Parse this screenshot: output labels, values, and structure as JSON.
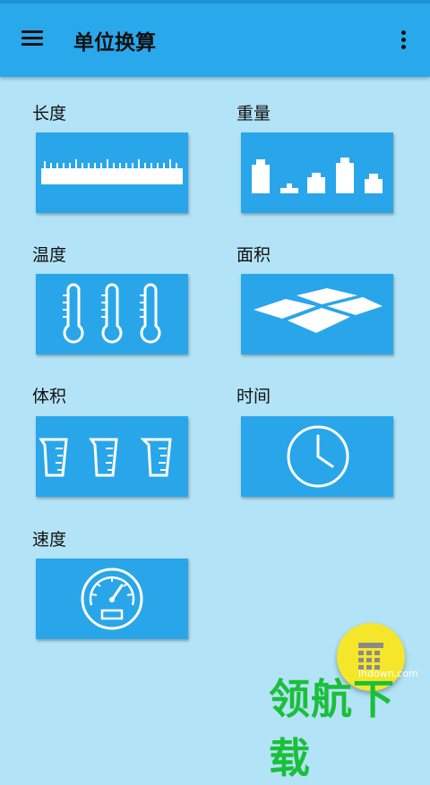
{
  "app_bar": {
    "title": "单位换算",
    "menu_icon": "hamburger-menu-icon",
    "more_icon": "more-vertical-icon"
  },
  "categories": [
    {
      "label": "长度",
      "icon": "ruler-icon"
    },
    {
      "label": "重量",
      "icon": "weights-icon"
    },
    {
      "label": "温度",
      "icon": "thermometer-icon"
    },
    {
      "label": "面积",
      "icon": "area-tiles-icon"
    },
    {
      "label": "体积",
      "icon": "measuring-cup-icon"
    },
    {
      "label": "时间",
      "icon": "clock-icon"
    },
    {
      "label": "速度",
      "icon": "speedometer-icon"
    }
  ],
  "fab": {
    "icon": "calculator-keypad-icon"
  },
  "watermark": {
    "url": "lhdown.com",
    "text": "领航下载"
  },
  "colors": {
    "app_bar": "#2aa8ec",
    "tile": "#29a6ea",
    "background": "#b3e3f7",
    "fab": "#f5e62a",
    "watermark": "#1bbf3a"
  }
}
